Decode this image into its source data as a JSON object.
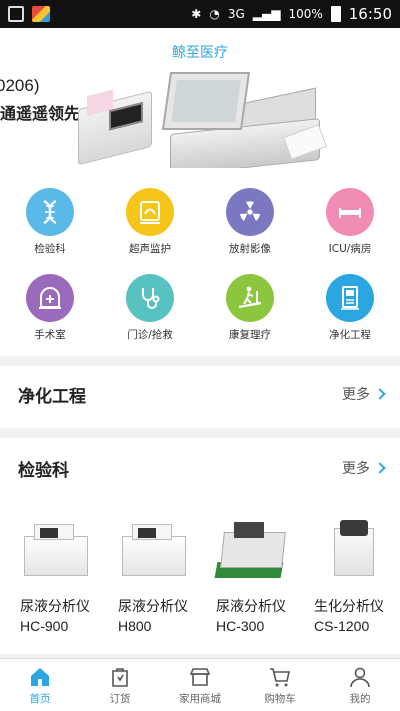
{
  "status_bar": {
    "battery": "100%",
    "time": "16:50",
    "network": "3G"
  },
  "app_title": "鲸至医疗",
  "banner": {
    "model_fragment": "0206)",
    "slogan_fragment": "通遥遥领先"
  },
  "categories": [
    {
      "label": "检验科",
      "color": "#5bb9e8"
    },
    {
      "label": "超声监护",
      "color": "#f5c518"
    },
    {
      "label": "放射影像",
      "color": "#7b78c2"
    },
    {
      "label": "ICU/病房",
      "color": "#f08cb4"
    },
    {
      "label": "手术室",
      "color": "#9a6bbd"
    },
    {
      "label": "门诊/抢救",
      "color": "#58c2c0"
    },
    {
      "label": "康复理疗",
      "color": "#8cc63f"
    },
    {
      "label": "净化工程",
      "color": "#2aa6e0"
    }
  ],
  "section_purification": {
    "title": "净化工程",
    "more": "更多"
  },
  "section_lab": {
    "title": "检验科",
    "more": "更多",
    "products": [
      {
        "name": "尿液分析仪",
        "model": "HC-900"
      },
      {
        "name": "尿液分析仪",
        "model": "H800"
      },
      {
        "name": "尿液分析仪",
        "model": "HC-300"
      },
      {
        "name": "生化分析仪",
        "model": "CS-1200"
      }
    ]
  },
  "nav": [
    {
      "label": "首页",
      "icon": "home-icon",
      "active": true
    },
    {
      "label": "订货",
      "icon": "order-icon"
    },
    {
      "label": "家用商城",
      "icon": "shop-icon"
    },
    {
      "label": "购物车",
      "icon": "cart-icon"
    },
    {
      "label": "我的",
      "icon": "user-icon"
    }
  ],
  "accent": "#2aa6e0"
}
